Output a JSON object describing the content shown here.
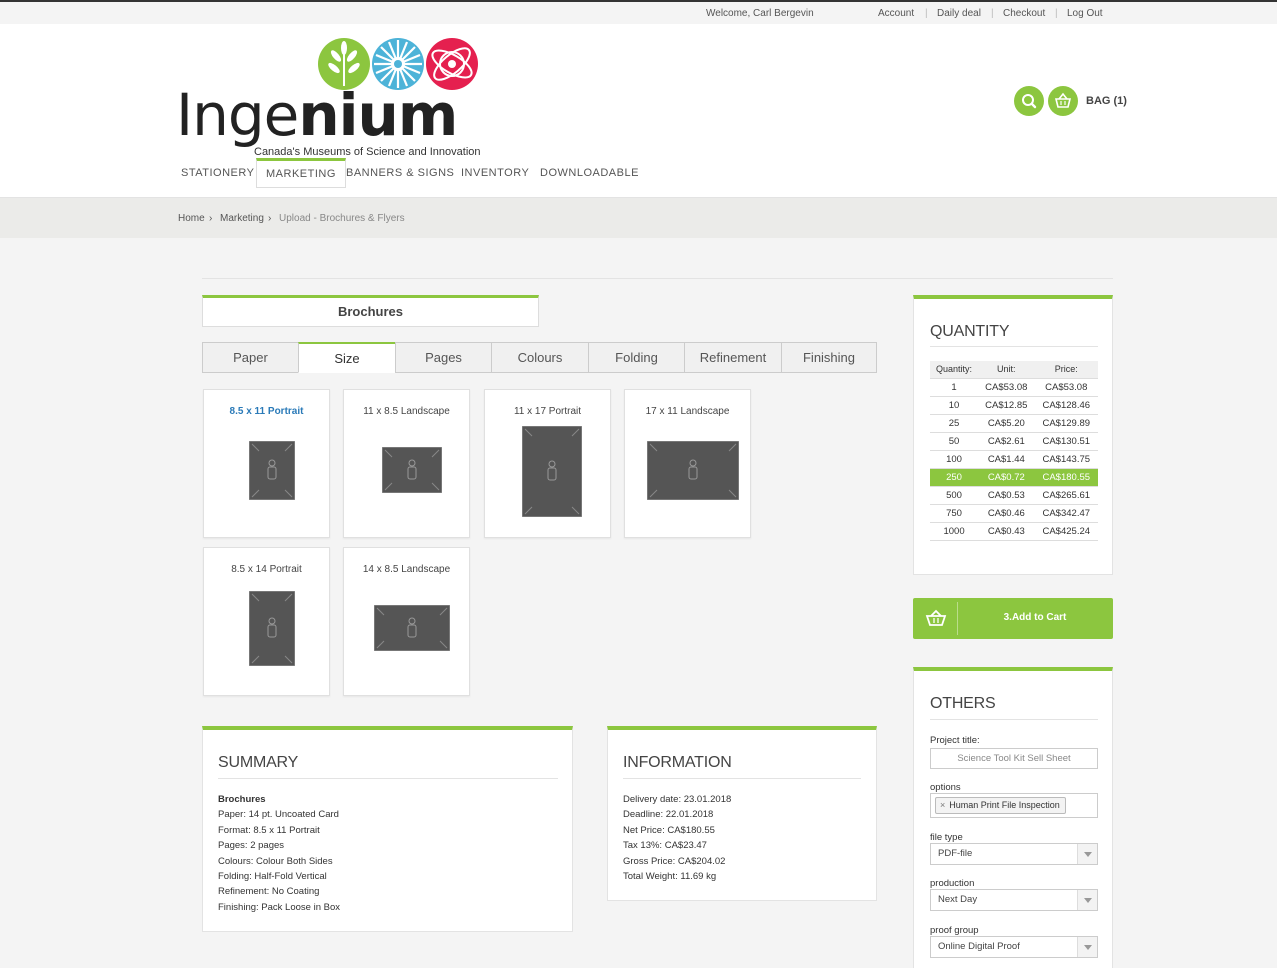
{
  "topbar": {
    "welcome": "Welcome, Carl Bergevin",
    "links": [
      "Account",
      "Daily deal",
      "Checkout",
      "Log Out"
    ]
  },
  "logo": {
    "name_thin": "Inge",
    "name_bold": "nium",
    "tagline": "Canada's Museums of Science and Innovation"
  },
  "header": {
    "bag_label": "BAG (1)"
  },
  "nav": [
    "STATIONERY",
    "MARKETING",
    "BANNERS & SIGNS",
    "INVENTORY",
    "DOWNLOADABLE"
  ],
  "breadcrumb": [
    "Home",
    "Marketing",
    "Upload - Brochures & Flyers"
  ],
  "product": {
    "title": "Brochures",
    "tabs": [
      "Paper",
      "Size",
      "Pages",
      "Colours",
      "Folding",
      "Refinement",
      "Finishing"
    ],
    "active_tab": "Size",
    "sizes": [
      "8.5 x 11 Portrait",
      "11 x 8.5 Landscape",
      "11 x 17 Portrait",
      "17 x 11 Landscape",
      "8.5 x 14 Portrait",
      "14 x 8.5 Landscape"
    ],
    "selected_size": "8.5 x 11 Portrait"
  },
  "summary": {
    "heading": "SUMMARY",
    "product": "Brochures",
    "lines": [
      "Paper: 14 pt. Uncoated Card",
      "Format: 8.5 x 11 Portrait",
      "Pages: 2 pages",
      "Colours: Colour Both Sides",
      "Folding: Half-Fold Vertical",
      "Refinement: No Coating",
      "Finishing: Pack Loose in Box"
    ]
  },
  "information": {
    "heading": "INFORMATION",
    "lines": [
      "Delivery date: 23.01.2018",
      "Deadline: 22.01.2018",
      "Net Price: CA$180.55",
      "Tax 13%: CA$23.47",
      "Gross Price: CA$204.02",
      "Total Weight: 11.69 kg"
    ]
  },
  "quantity": {
    "heading": "QUANTITY",
    "headers": [
      "Quantity:",
      "Unit:",
      "Price:"
    ],
    "rows": [
      [
        "1",
        "CA$53.08",
        "CA$53.08"
      ],
      [
        "10",
        "CA$12.85",
        "CA$128.46"
      ],
      [
        "25",
        "CA$5.20",
        "CA$129.89"
      ],
      [
        "50",
        "CA$2.61",
        "CA$130.51"
      ],
      [
        "100",
        "CA$1.44",
        "CA$143.75"
      ],
      [
        "250",
        "CA$0.72",
        "CA$180.55"
      ],
      [
        "500",
        "CA$0.53",
        "CA$265.61"
      ],
      [
        "750",
        "CA$0.46",
        "CA$342.47"
      ],
      [
        "1000",
        "CA$0.43",
        "CA$425.24"
      ]
    ],
    "highlighted_quantity": "250"
  },
  "cart": {
    "button_label": "3.Add to Cart"
  },
  "others": {
    "heading": "OTHERS",
    "project_title_label": "Project title:",
    "project_title_placeholder": "Science Tool Kit Sell Sheet",
    "options_label": "options",
    "options_tag": "Human Print File Inspection",
    "file_type_label": "file type",
    "file_type_value": "PDF-file",
    "production_label": "production",
    "production_value": "Next Day",
    "proof_group_label": "proof group",
    "proof_group_value": "Online Digital Proof"
  },
  "colors": {
    "accent": "#8cc63f",
    "selected_link": "#2a7ab8"
  }
}
